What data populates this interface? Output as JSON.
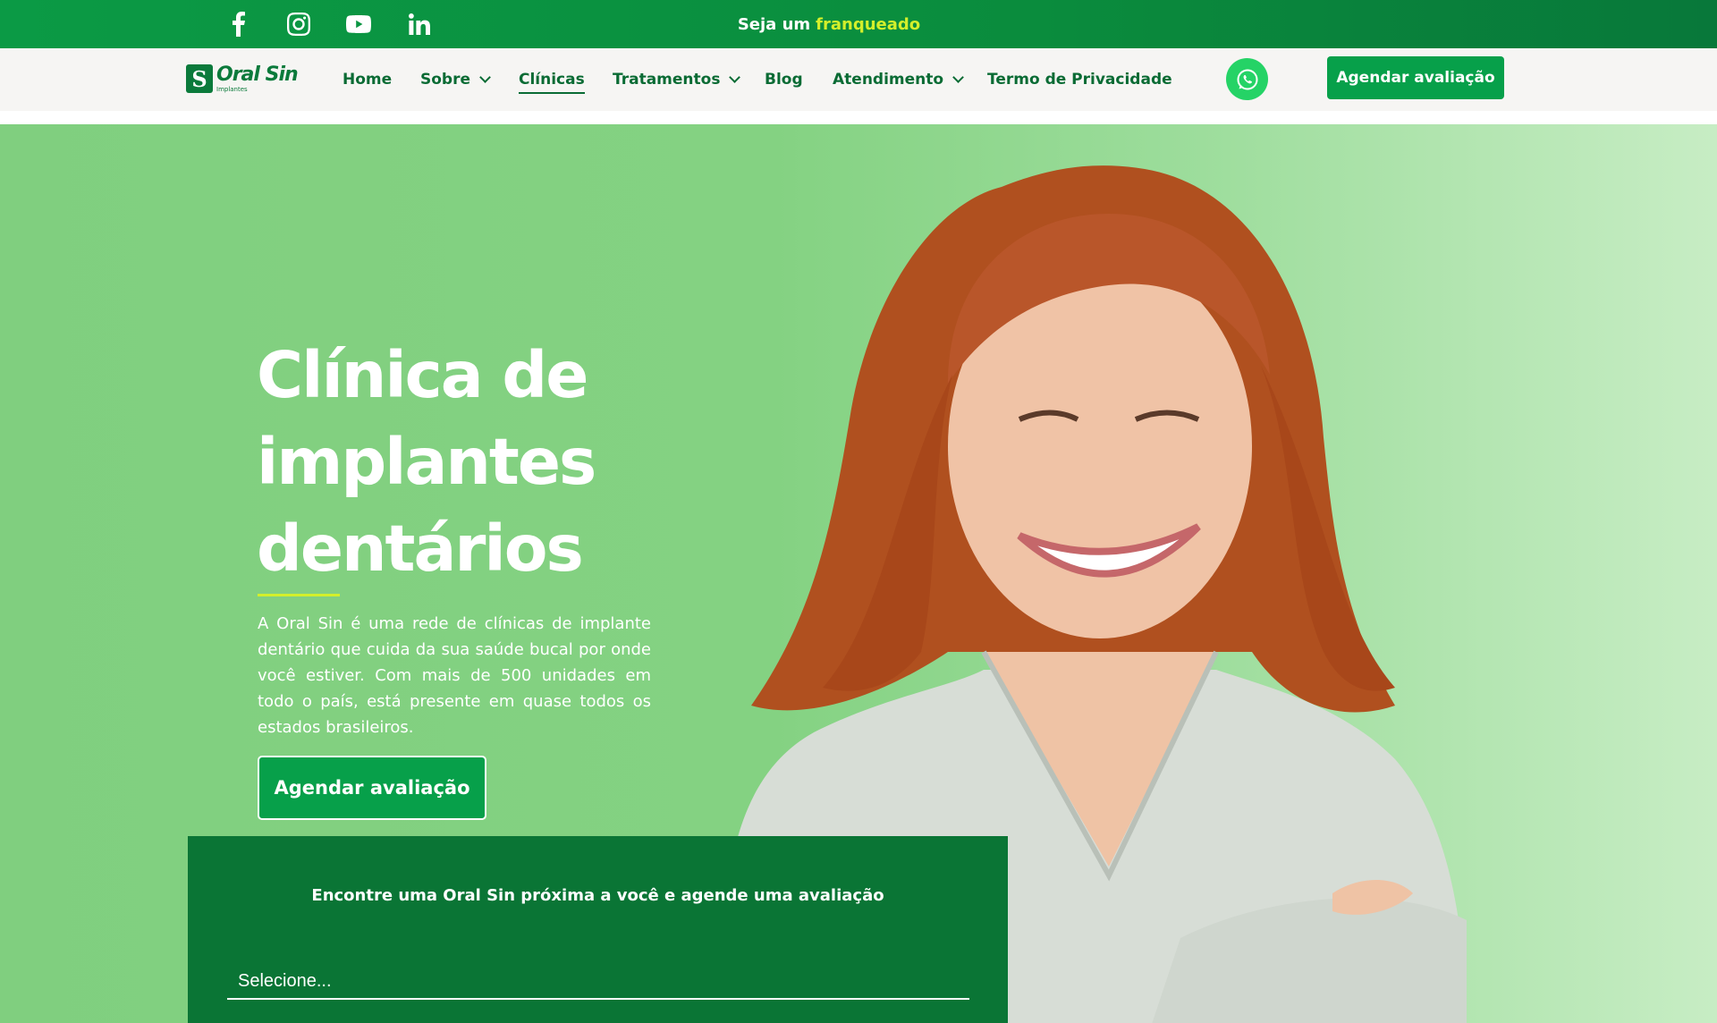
{
  "topbar": {
    "social": [
      {
        "name": "facebook-icon"
      },
      {
        "name": "instagram-icon"
      },
      {
        "name": "youtube-icon"
      },
      {
        "name": "linkedin-icon"
      }
    ],
    "franchise_prefix": "Seja um",
    "franchise_highlight": "franqueado"
  },
  "nav": {
    "logo_text": "Oral Sin",
    "logo_sub": "Implantes",
    "items": [
      {
        "label": "Home"
      },
      {
        "label": "Sobre"
      },
      {
        "label": "Clínicas"
      },
      {
        "label": "Tratamentos"
      },
      {
        "label": "Blog"
      },
      {
        "label": "Atendimento"
      },
      {
        "label": "Termo de Privacidade"
      }
    ],
    "cta": "Agendar avaliação"
  },
  "hero": {
    "title_lines": [
      "Clínica de",
      "implantes",
      "dentários"
    ],
    "description": "A Oral Sin é uma rede de clínicas de implante dentário que cuida da sua saúde bucal por onde você estiver. Com mais de 500 unidades em todo o país, está presente em quase todos os estados brasileiros.",
    "cta": "Agendar avaliação"
  },
  "finder": {
    "title": "Encontre uma Oral Sin próxima a você e agende uma avaliação",
    "select_value": "Selecione..."
  },
  "colors": {
    "topbar": "#0b9a45",
    "brand_green": "#0a7535",
    "accent_lime": "#d3ef2b",
    "cta_green": "#07a04a",
    "hero_bg": "#84d282"
  }
}
